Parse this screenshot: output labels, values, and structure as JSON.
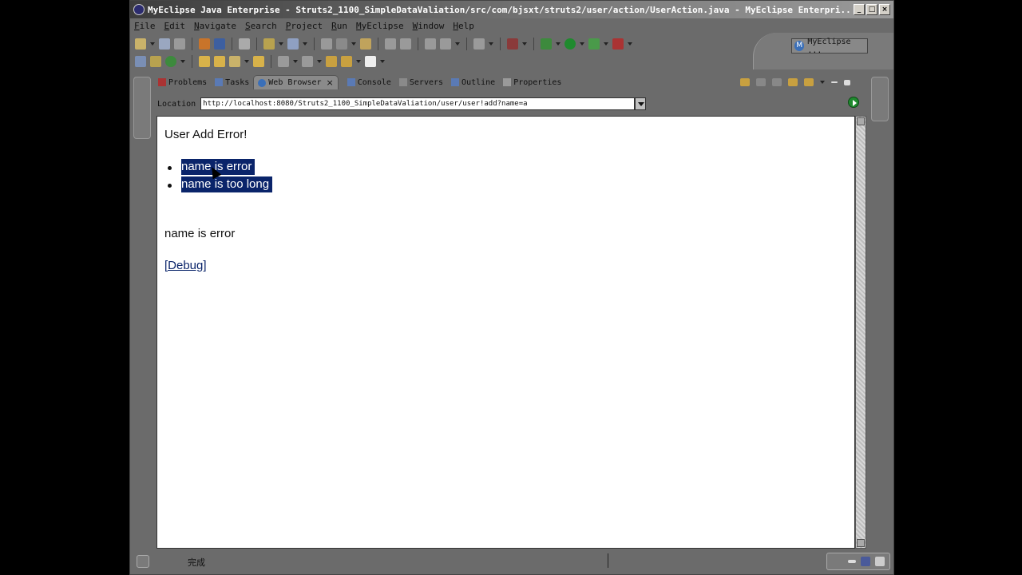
{
  "window": {
    "title": "MyEclipse Java Enterprise - Struts2_1100_SimpleDataValiation/src/com/bjsxt/struts2/user/action/UserAction.java - MyEclipse Enterpri..."
  },
  "menu": [
    "File",
    "Edit",
    "Navigate",
    "Search",
    "Project",
    "Run",
    "MyEclipse",
    "Window",
    "Help"
  ],
  "perspective": {
    "label": "MyEclipse ..."
  },
  "view_tabs": [
    {
      "label": "Problems",
      "active": false
    },
    {
      "label": "Tasks",
      "active": false
    },
    {
      "label": "Web Browser",
      "active": true
    },
    {
      "label": "Console",
      "active": false
    },
    {
      "label": "Servers",
      "active": false
    },
    {
      "label": "Outline",
      "active": false
    },
    {
      "label": "Properties",
      "active": false
    }
  ],
  "location": {
    "label": "Location",
    "url": "http://localhost:8080/Struts2_1100_SimpleDataValiation/user/user!add?name=a"
  },
  "page": {
    "heading": "User Add Error!",
    "errors": [
      "name is error",
      "name is too long"
    ],
    "field_error": "name is error",
    "debug_link": "[Debug]"
  },
  "status": {
    "text": "完成"
  },
  "colors": {
    "selection": "#0a246a",
    "chrome": "#6b6b6b",
    "go_button": "#1f8a2e"
  }
}
